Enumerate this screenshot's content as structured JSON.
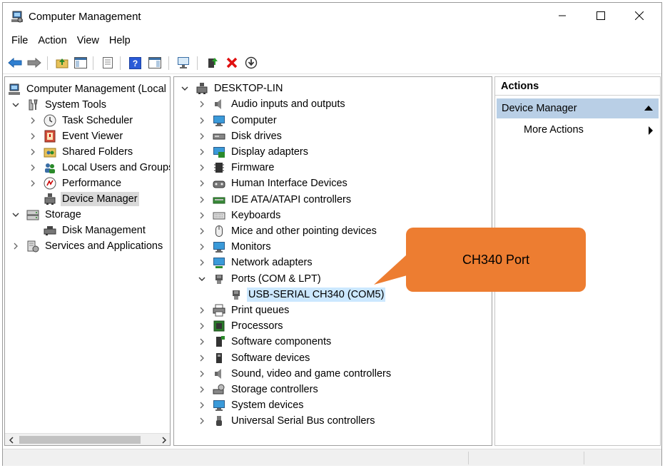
{
  "window": {
    "title": "Computer Management"
  },
  "menu": [
    "File",
    "Action",
    "View",
    "Help"
  ],
  "tree": {
    "root": "Computer Management (Local",
    "system_tools": "System Tools",
    "task_scheduler": "Task Scheduler",
    "event_viewer": "Event Viewer",
    "shared_folders": "Shared Folders",
    "local_users": "Local Users and Groups",
    "performance": "Performance",
    "device_manager": "Device Manager",
    "storage": "Storage",
    "disk_management": "Disk Management",
    "services": "Services and Applications"
  },
  "devices": {
    "computer_name": "DESKTOP-LIN",
    "categories": [
      "Audio inputs and outputs",
      "Computer",
      "Disk drives",
      "Display adapters",
      "Firmware",
      "Human Interface Devices",
      "IDE ATA/ATAPI controllers",
      "Keyboards",
      "Mice and other pointing devices",
      "Monitors",
      "Network adapters",
      "Ports (COM & LPT)",
      "Print queues",
      "Processors",
      "Software components",
      "Software devices",
      "Sound, video and game controllers",
      "Storage controllers",
      "System devices",
      "Universal Serial Bus controllers"
    ],
    "port_child": "USB-SERIAL CH340 (COM5)"
  },
  "actions": {
    "header": "Actions",
    "section": "Device Manager",
    "more": "More Actions"
  },
  "callout": {
    "text": "CH340 Port",
    "color": "#ed7d31"
  },
  "colors": {
    "selection": "#cce8ff",
    "actions_section": "#b9cfe6"
  }
}
